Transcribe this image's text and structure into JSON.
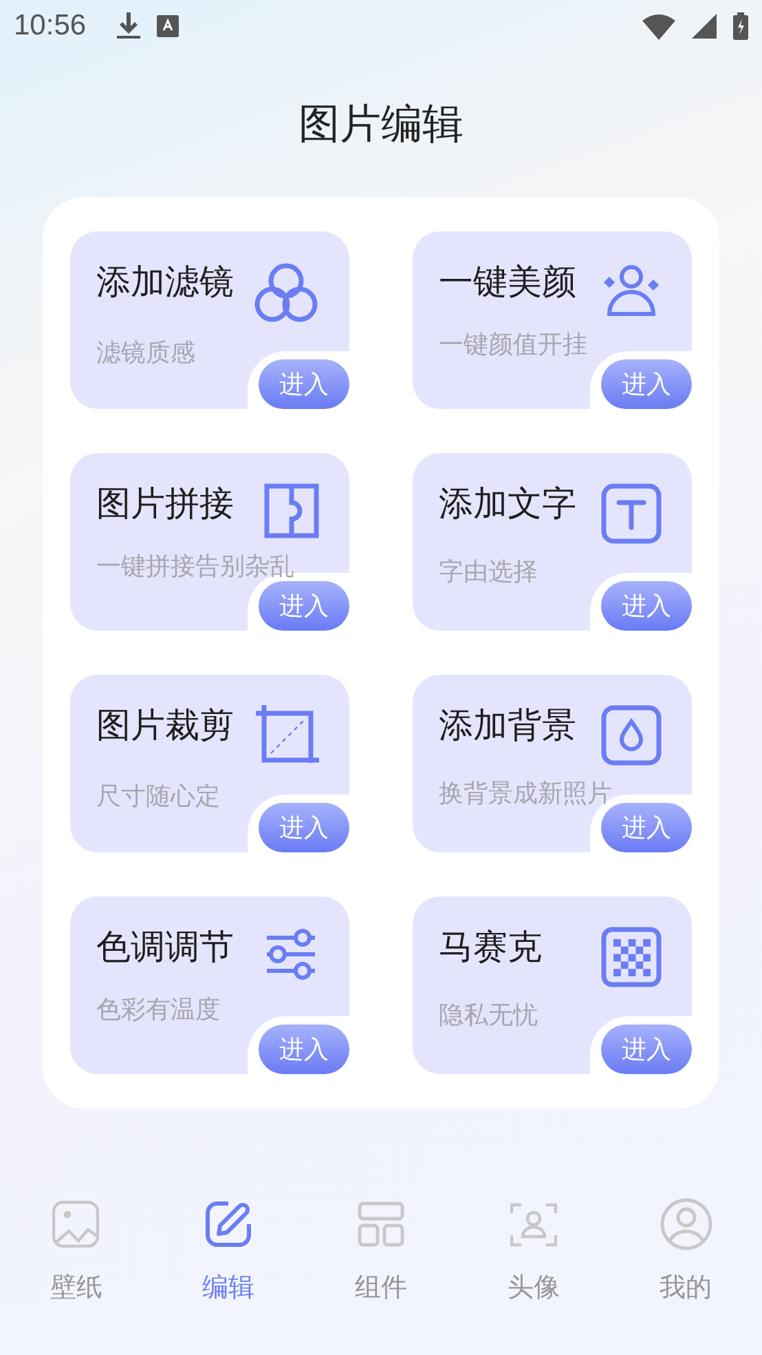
{
  "status_bar": {
    "time": "10:56"
  },
  "title": "图片编辑",
  "cards": [
    {
      "kind": "filter",
      "title": "添加滤镜",
      "subtitle": "滤镜质感",
      "button": "进入"
    },
    {
      "kind": "beauty",
      "title": "一键美颜",
      "subtitle": "一键颜值开挂",
      "button": "进入"
    },
    {
      "kind": "collage",
      "title": "图片拼接",
      "subtitle": "一键拼接告别杂乱",
      "button": "进入"
    },
    {
      "kind": "text",
      "title": "添加文字",
      "subtitle": "字由选择",
      "button": "进入"
    },
    {
      "kind": "crop",
      "title": "图片裁剪",
      "subtitle": "尺寸随心定",
      "button": "进入"
    },
    {
      "kind": "background",
      "title": "添加背景",
      "subtitle": "换背景成新照片",
      "button": "进入"
    },
    {
      "kind": "tone",
      "title": "色调调节",
      "subtitle": "色彩有温度",
      "button": "进入"
    },
    {
      "kind": "mosaic",
      "title": "马赛克",
      "subtitle": "隐私无忧",
      "button": "进入"
    }
  ],
  "nav": [
    {
      "kind": "wallpaper",
      "label": "壁纸",
      "selected": false
    },
    {
      "kind": "edit",
      "label": "编辑",
      "selected": true
    },
    {
      "kind": "widgets",
      "label": "组件",
      "selected": false
    },
    {
      "kind": "avatar",
      "label": "头像",
      "selected": false
    },
    {
      "kind": "profile",
      "label": "我的",
      "selected": false
    }
  ]
}
